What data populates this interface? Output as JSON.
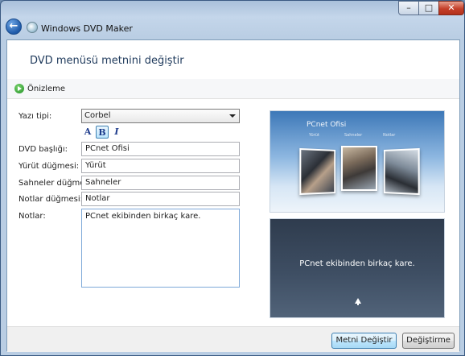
{
  "window": {
    "app_title": "Windows DVD Maker",
    "controls": {
      "minimize": "–",
      "maximize": "□",
      "close": "✕"
    }
  },
  "header": {
    "title": "DVD menüsü metnini değiştir"
  },
  "preview_bar": {
    "label": "Önizleme",
    "icon": "play-icon"
  },
  "form": {
    "font_label": "Yazı tipi:",
    "font_value": "Corbel",
    "format_buttons": {
      "color": "A",
      "bold": "B",
      "italic": "I"
    },
    "dvd_title_label": "DVD başlığı:",
    "dvd_title_value": "PCnet Ofisi",
    "play_button_label": "Yürüt düğmesi:",
    "play_button_value": "Yürüt",
    "scenes_button_label": "Sahneler düğmesi:",
    "scenes_button_value": "Sahneler",
    "notes_button_label": "Notlar düğmesi:",
    "notes_button_value": "Notlar",
    "notes_label": "Notlar:",
    "notes_value": "PCnet ekibinden birkaç kare."
  },
  "preview": {
    "menu_title": "PCnet Ofisi",
    "menu_items": [
      "Yürüt",
      "Sahneler",
      "Notlar"
    ],
    "notes_text": "PCnet ekibinden birkaç kare."
  },
  "footer": {
    "apply_button": "Metni Değiştir",
    "cancel_button": "Değiştirme"
  },
  "colors": {
    "accent": "#3c7fb1",
    "header_text": "#1e395b",
    "close_red": "#c4402a"
  }
}
